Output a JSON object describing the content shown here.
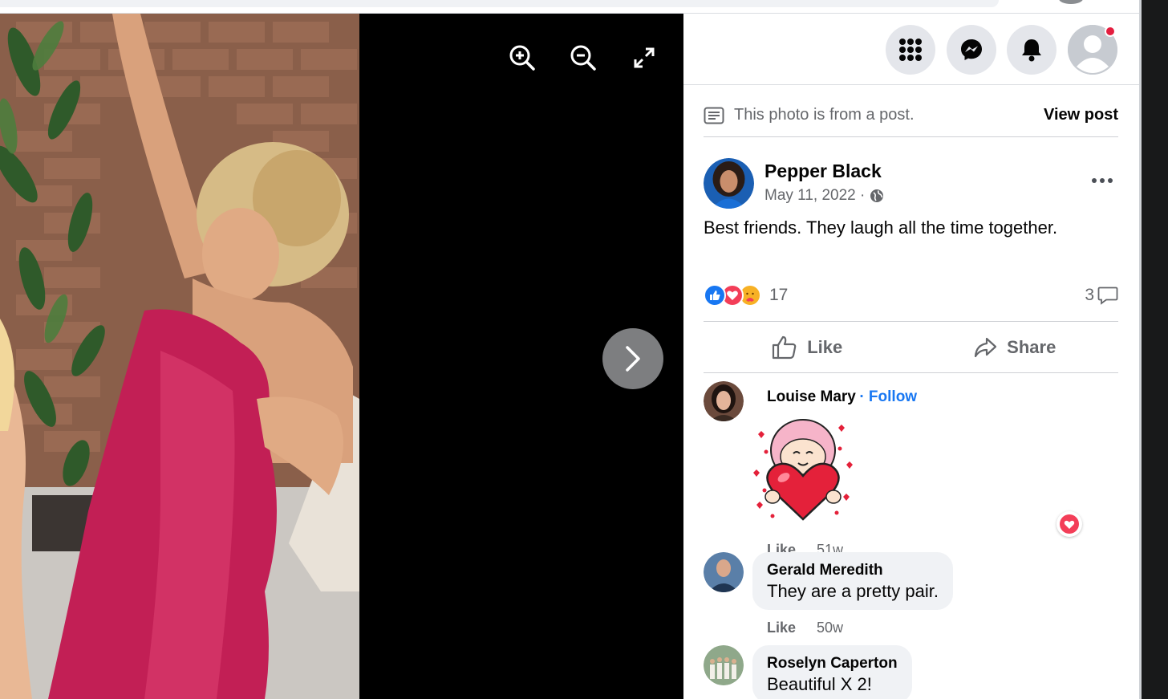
{
  "viewer": {
    "tools": [
      "zoom-in",
      "zoom-out",
      "fullscreen"
    ],
    "next_icon": "chevron-right-icon"
  },
  "panel": {
    "top_buttons": [
      "menu-grid-icon",
      "messenger-icon",
      "notifications-bell-icon",
      "profile-avatar"
    ],
    "from_post_text": "This photo is from a post.",
    "view_post_label": "View post",
    "author": {
      "name": "Pepper Black",
      "date": "May 11, 2022 ·",
      "privacy_icon": "globe-icon"
    },
    "caption": "Best friends. They laugh all the time together.",
    "reaction_count": "17",
    "comment_count": "3",
    "like_label": "Like",
    "share_label": "Share"
  },
  "comments": [
    {
      "name": "Louise Mary",
      "follow": "· Follow",
      "sticker": "heart-hug-sticker",
      "like": "Like",
      "time": "51w",
      "reaction": "love"
    },
    {
      "name": "Gerald Meredith",
      "text": "They are a pretty pair.",
      "like": "Like",
      "time": "50w"
    },
    {
      "name": "Roselyn Caperton",
      "text": "Beautiful X 2!"
    }
  ],
  "colors": {
    "accent": "#1877f2",
    "love": "#f33e58",
    "notification": "#e41e3f"
  }
}
